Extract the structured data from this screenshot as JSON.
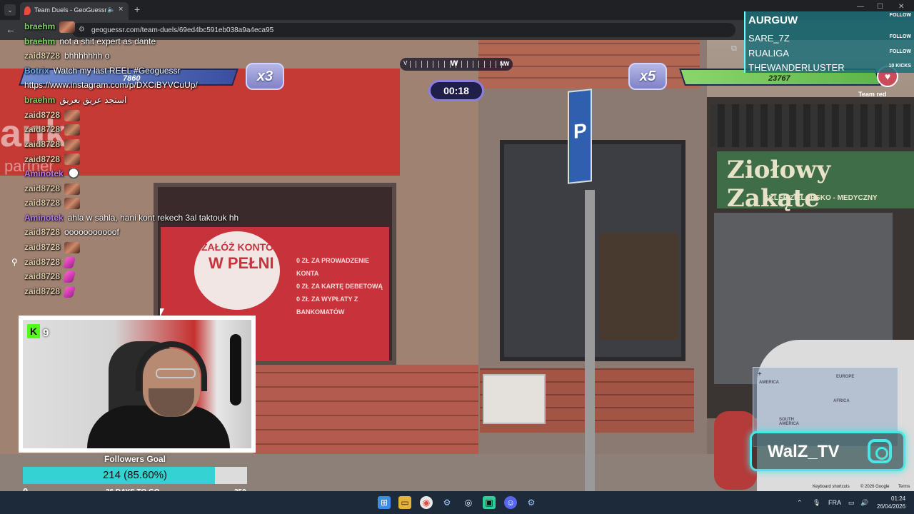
{
  "browser": {
    "tab_title": "Team Duels - GeoGuessr",
    "url": "geoguessr.com/team-duels/69ed4bc591eb038a9a4eca95"
  },
  "scene": {
    "bank_text": "ank",
    "bank_sub": "partner",
    "poster_line1": "ZAŁÓŻ KONTO",
    "poster_line2": "W PEŁNI",
    "poster_items": [
      "0 ZŁ ZA PROWADZENIE KONTA",
      "0 ZŁ ZA KARTĘ DEBETOWĄ",
      "0 ZŁ ZA WYPŁATY Z BANKOMATÓW"
    ],
    "shop_sign": "Ziołowy Zakąte",
    "shop_sub": "SKLEP ZIELARSKO - MEDYCZNY",
    "parking": "P"
  },
  "hud": {
    "left_score": "7860",
    "left_mult": "x3",
    "right_mult": "x5",
    "right_score": "23767",
    "team_label": "Team red",
    "timer": "00:18",
    "compass_w": "W",
    "compass_nw": "NW",
    "compass_v": "V"
  },
  "chat": [
    {
      "user": "braehm",
      "color": "#7fd36a",
      "text": "",
      "emote": "face"
    },
    {
      "user": "braehm",
      "color": "#7fd36a",
      "text": "not a shit expert as dante",
      "emote": ""
    },
    {
      "user": "zaid8728",
      "color": "#d9c7a6",
      "text": "bhhhhhhh o",
      "emote": ""
    },
    {
      "user": "Botrix",
      "color": "#6fa8e8",
      "text": "Watch my last REEL #Geoguessr",
      "emote": ""
    },
    {
      "user": "",
      "color": "#ffffff",
      "text": "https://www.instagram.com/p/DXCiBYVCuUp/",
      "emote": ""
    },
    {
      "user": "braehm",
      "color": "#7fd36a",
      "text": "استجد عريق بعريق",
      "emote": ""
    },
    {
      "user": "zaid8728",
      "color": "#d9c7a6",
      "text": "",
      "emote": "face"
    },
    {
      "user": "zaid8728",
      "color": "#d9c7a6",
      "text": "",
      "emote": "face"
    },
    {
      "user": "zaid8728",
      "color": "#d9c7a6",
      "text": "",
      "emote": "face"
    },
    {
      "user": "zaid8728",
      "color": "#d9c7a6",
      "text": "",
      "emote": "face"
    },
    {
      "user": "Aminotek",
      "color": "#b47cf0",
      "text": "",
      "emote": "ghost"
    },
    {
      "user": "zaid8728",
      "color": "#d9c7a6",
      "text": "",
      "emote": "face"
    },
    {
      "user": "zaid8728",
      "color": "#d9c7a6",
      "text": "",
      "emote": "face"
    },
    {
      "user": "Aminotek",
      "color": "#b47cf0",
      "text": "ahla w sahla, hani kont rekech 3al taktouk hh",
      "emote": ""
    },
    {
      "user": "zaid8728",
      "color": "#d9c7a6",
      "text": "ooooooooooof",
      "emote": ""
    },
    {
      "user": "zaid8728",
      "color": "#d9c7a6",
      "text": "",
      "emote": "face"
    },
    {
      "user": "zaid8728",
      "color": "#d9c7a6",
      "text": "",
      "emote": "pink"
    },
    {
      "user": "zaid8728",
      "color": "#d9c7a6",
      "text": "",
      "emote": "pink"
    },
    {
      "user": "zaid8728",
      "color": "#d9c7a6",
      "text": "",
      "emote": "pink"
    }
  ],
  "kick": {
    "logo": "K",
    "viewers": "9"
  },
  "goal": {
    "title": "Followers Goal",
    "progress_text": "214 (85.60%)",
    "progress": 0.856,
    "min": "0",
    "days_left": "36 DAYS TO GO",
    "max": "250"
  },
  "leaderboard": [
    {
      "name": "AURGUW",
      "tag": "FOLLOW"
    },
    {
      "name": "SARE_7Z",
      "tag": "FOLLOW"
    },
    {
      "name": "RUALIGA",
      "tag": "FOLLOW"
    },
    {
      "name": "THEWANDERLUSTER",
      "tag": "10 KICKS"
    }
  ],
  "minimap": {
    "europe": "EUROPE",
    "africa": "AFRICA",
    "america": "AMERICA",
    "south_america": "SOUTH AMERICA",
    "zoom_in": "+",
    "shortcuts": "Keyboard shortcuts",
    "copyright": "© 2026 Google",
    "terms": "Terms"
  },
  "brand": {
    "name": "WalZ_TV"
  },
  "taskbar": {
    "lang": "FRA",
    "time": "01:24",
    "date": "26/04/2026"
  }
}
